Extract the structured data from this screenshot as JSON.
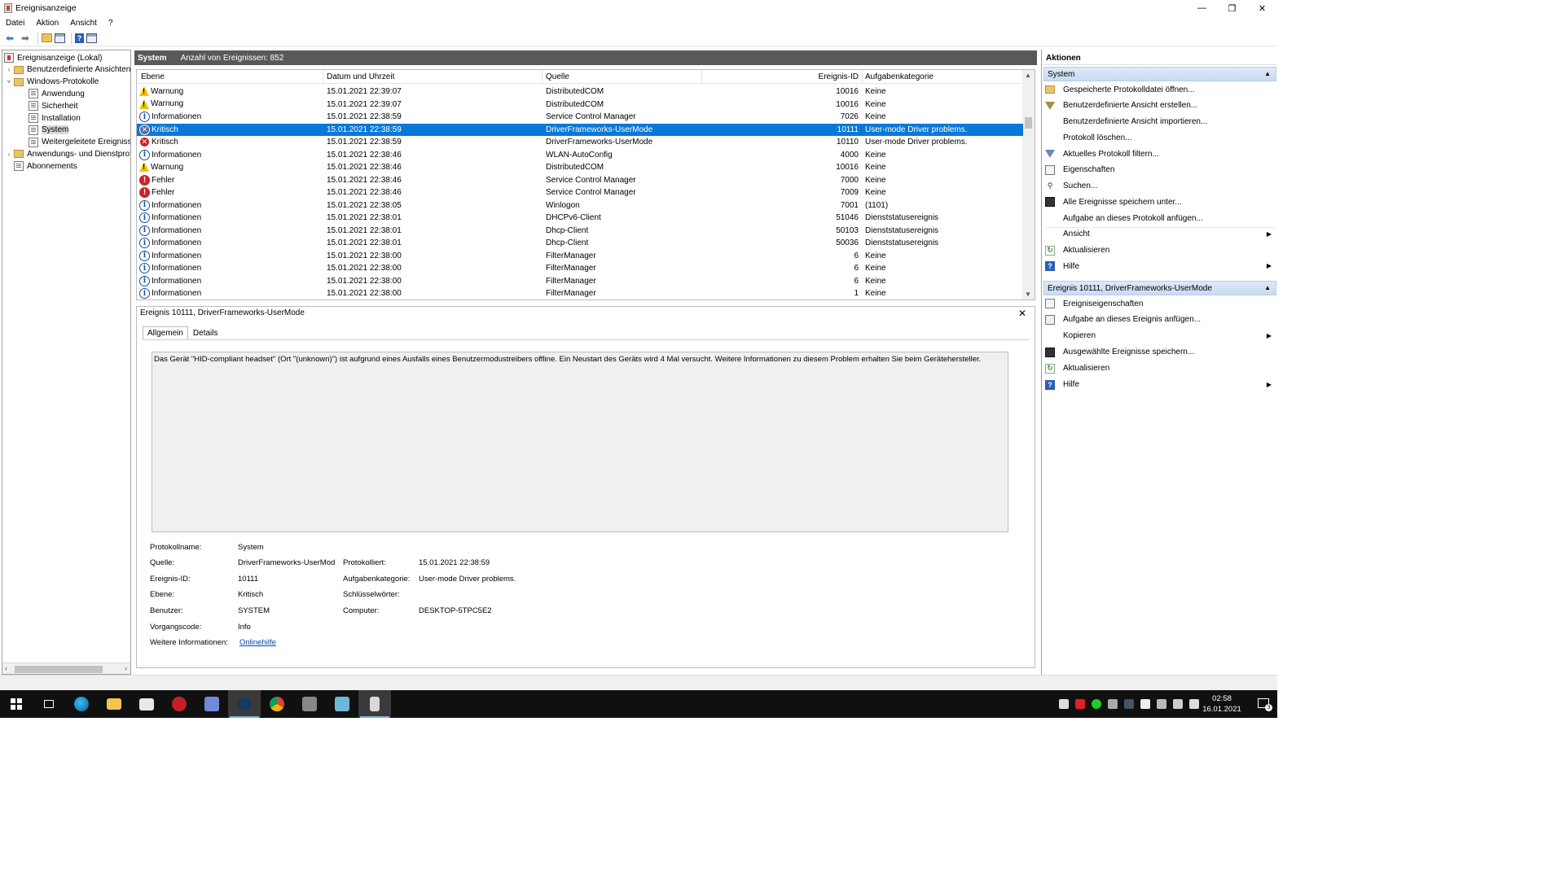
{
  "window": {
    "title": "Ereignisanzeige",
    "minimize": "—",
    "maximize": "❐",
    "close": "✕"
  },
  "menu": [
    "Datei",
    "Aktion",
    "Ansicht",
    "?"
  ],
  "tree": {
    "items": [
      {
        "label": "Ereignisanzeige (Lokal)",
        "level": 0,
        "icon": "event-viewer-icon"
      },
      {
        "label": "Benutzerdefinierte Ansichten",
        "level": 1,
        "icon": "folder-icon",
        "expand": "›"
      },
      {
        "label": "Windows-Protokolle",
        "level": 1,
        "icon": "folder-icon",
        "expand": "˅"
      },
      {
        "label": "Anwendung",
        "level": 2,
        "icon": "log-icon"
      },
      {
        "label": "Sicherheit",
        "level": 2,
        "icon": "log-icon"
      },
      {
        "label": "Installation",
        "level": 2,
        "icon": "log-icon"
      },
      {
        "label": "System",
        "level": 2,
        "icon": "log-icon",
        "selected": true
      },
      {
        "label": "Weitergeleitete Ereignisse",
        "level": 2,
        "icon": "log-icon"
      },
      {
        "label": "Anwendungs- und Dienstprotokolle",
        "level": 1,
        "icon": "folder-icon",
        "expand": "›"
      },
      {
        "label": "Abonnements",
        "level": 1,
        "icon": "log-icon"
      }
    ]
  },
  "center": {
    "log_name": "System",
    "count_text": "Anzahl von Ereignissen: 852",
    "columns": {
      "level": "Ebene",
      "datetime": "Datum und Uhrzeit",
      "source": "Quelle",
      "event_id": "Ereignis-ID",
      "category": "Aufgabenkategorie"
    },
    "rows": [
      {
        "level": "Warnung",
        "type": "warn",
        "datetime": "15.01.2021 22:39:07",
        "source": "DistributedCOM",
        "event_id": "10016",
        "category": "Keine"
      },
      {
        "level": "Warnung",
        "type": "warn",
        "datetime": "15.01.2021 22:39:07",
        "source": "DistributedCOM",
        "event_id": "10016",
        "category": "Keine"
      },
      {
        "level": "Informationen",
        "type": "info",
        "datetime": "15.01.2021 22:38:59",
        "source": "Service Control Manager",
        "event_id": "7026",
        "category": "Keine"
      },
      {
        "level": "Kritisch",
        "type": "crit",
        "datetime": "15.01.2021 22:38:59",
        "source": "DriverFrameworks-UserMode",
        "event_id": "10111",
        "category": "User-mode Driver problems.",
        "selected": true
      },
      {
        "level": "Kritisch",
        "type": "crit",
        "datetime": "15.01.2021 22:38:59",
        "source": "DriverFrameworks-UserMode",
        "event_id": "10110",
        "category": "User-mode Driver problems."
      },
      {
        "level": "Informationen",
        "type": "info",
        "datetime": "15.01.2021 22:38:46",
        "source": "WLAN-AutoConfig",
        "event_id": "4000",
        "category": "Keine"
      },
      {
        "level": "Warnung",
        "type": "warn",
        "datetime": "15.01.2021 22:38:46",
        "source": "DistributedCOM",
        "event_id": "10016",
        "category": "Keine"
      },
      {
        "level": "Fehler",
        "type": "err",
        "datetime": "15.01.2021 22:38:46",
        "source": "Service Control Manager",
        "event_id": "7000",
        "category": "Keine"
      },
      {
        "level": "Fehler",
        "type": "err",
        "datetime": "15.01.2021 22:38:46",
        "source": "Service Control Manager",
        "event_id": "7009",
        "category": "Keine"
      },
      {
        "level": "Informationen",
        "type": "info",
        "datetime": "15.01.2021 22:38:05",
        "source": "Winlogon",
        "event_id": "7001",
        "category": "(1101)"
      },
      {
        "level": "Informationen",
        "type": "info",
        "datetime": "15.01.2021 22:38:01",
        "source": "DHCPv6-Client",
        "event_id": "51046",
        "category": "Dienststatusereignis"
      },
      {
        "level": "Informationen",
        "type": "info",
        "datetime": "15.01.2021 22:38:01",
        "source": "Dhcp-Client",
        "event_id": "50103",
        "category": "Dienststatusereignis"
      },
      {
        "level": "Informationen",
        "type": "info",
        "datetime": "15.01.2021 22:38:01",
        "source": "Dhcp-Client",
        "event_id": "50036",
        "category": "Dienststatusereignis"
      },
      {
        "level": "Informationen",
        "type": "info",
        "datetime": "15.01.2021 22:38:00",
        "source": "FilterManager",
        "event_id": "6",
        "category": "Keine"
      },
      {
        "level": "Informationen",
        "type": "info",
        "datetime": "15.01.2021 22:38:00",
        "source": "FilterManager",
        "event_id": "6",
        "category": "Keine"
      },
      {
        "level": "Informationen",
        "type": "info",
        "datetime": "15.01.2021 22:38:00",
        "source": "FilterManager",
        "event_id": "6",
        "category": "Keine"
      },
      {
        "level": "Informationen",
        "type": "info",
        "datetime": "15.01.2021 22:38:00",
        "source": "FilterManager",
        "event_id": "1",
        "category": "Keine"
      }
    ]
  },
  "detail": {
    "title": "Ereignis 10111, DriverFrameworks-UserMode",
    "tabs": {
      "general": "Allgemein",
      "details": "Details"
    },
    "message": "Das Gerät \"HID-compliant headset\" (Ort \"(unknown)\") ist aufgrund eines Ausfalls eines Benutzermodustreibers offline. Ein Neustart des Geräts wird 4 Mal versucht. Weitere Informationen zu diesem Problem erhalten Sie beim Gerätehersteller.",
    "fields": {
      "log_name_label": "Protokollname:",
      "log_name": "System",
      "source_label": "Quelle:",
      "source": "DriverFrameworks-UserMod",
      "logged_label": "Protokolliert:",
      "logged": "15.01.2021 22:38:59",
      "event_id_label": "Ereignis-ID:",
      "event_id": "10111",
      "category_label": "Aufgabenkategorie:",
      "category": "User-mode Driver problems.",
      "level_label": "Ebene:",
      "level": "Kritisch",
      "keywords_label": "Schlüsselwörter:",
      "user_label": "Benutzer:",
      "user": "SYSTEM",
      "computer_label": "Computer:",
      "computer": "DESKTOP-5TPC5E2",
      "opcode_label": "Vorgangscode:",
      "opcode": "Info",
      "moreinfo_label": "Weitere Informationen:",
      "moreinfo_link": "Onlinehilfe"
    }
  },
  "actions": {
    "title": "Aktionen",
    "section1": "System",
    "section1_items": [
      {
        "label": "Gespeicherte Protokolldatei öffnen...",
        "icon": "open-log-icon"
      },
      {
        "label": "Benutzerdefinierte Ansicht erstellen...",
        "icon": "create-view-icon"
      },
      {
        "label": "Benutzerdefinierte Ansicht importieren...",
        "icon": ""
      },
      {
        "label": "Protokoll löschen...",
        "icon": ""
      },
      {
        "label": "Aktuelles Protokoll filtern...",
        "icon": "filter-icon"
      },
      {
        "label": "Eigenschaften",
        "icon": "properties-icon"
      },
      {
        "label": "Suchen...",
        "icon": "find-icon"
      },
      {
        "label": "Alle Ereignisse speichern unter...",
        "icon": "save-icon"
      },
      {
        "label": "Aufgabe an dieses Protokoll anfügen...",
        "icon": ""
      },
      {
        "label": "Ansicht",
        "icon": "",
        "submenu": true
      },
      {
        "label": "Aktualisieren",
        "icon": "refresh-icon"
      },
      {
        "label": "Hilfe",
        "icon": "help-icon",
        "submenu": true
      }
    ],
    "section2": "Ereignis 10111, DriverFrameworks-UserMode",
    "section2_items": [
      {
        "label": "Ereigniseigenschaften",
        "icon": "properties-icon"
      },
      {
        "label": "Aufgabe an dieses Ereignis anfügen...",
        "icon": "task-icon"
      },
      {
        "label": "Kopieren",
        "icon": "copy-icon",
        "submenu": true
      },
      {
        "label": "Ausgewählte Ereignisse speichern...",
        "icon": "save-icon"
      },
      {
        "label": "Aktualisieren",
        "icon": "refresh-icon"
      },
      {
        "label": "Hilfe",
        "icon": "help-icon",
        "submenu": true
      }
    ]
  },
  "taskbar": {
    "time": "02:58",
    "date": "16.01.2021",
    "notifications": "3"
  },
  "colors": {
    "selection": "#0a78d7",
    "header": "#595959",
    "taskbar": "#101010"
  }
}
